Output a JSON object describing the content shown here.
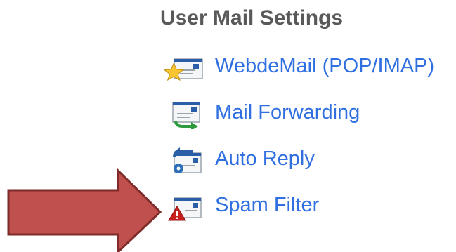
{
  "section": {
    "title": "User Mail Settings"
  },
  "menu": {
    "items": [
      {
        "label": "WebdeMail (POP/IMAP)",
        "icon": "mail-star-icon"
      },
      {
        "label": "Mail Forwarding",
        "icon": "mail-forward-icon"
      },
      {
        "label": "Auto Reply",
        "icon": "mail-auto-reply-icon"
      },
      {
        "label": "Spam Filter",
        "icon": "mail-spam-warning-icon"
      }
    ]
  },
  "annotation": {
    "icon": "red-pointer-arrow",
    "color": "#c0504d"
  },
  "colors": {
    "link": "#2f6fe0",
    "title": "#595959"
  }
}
